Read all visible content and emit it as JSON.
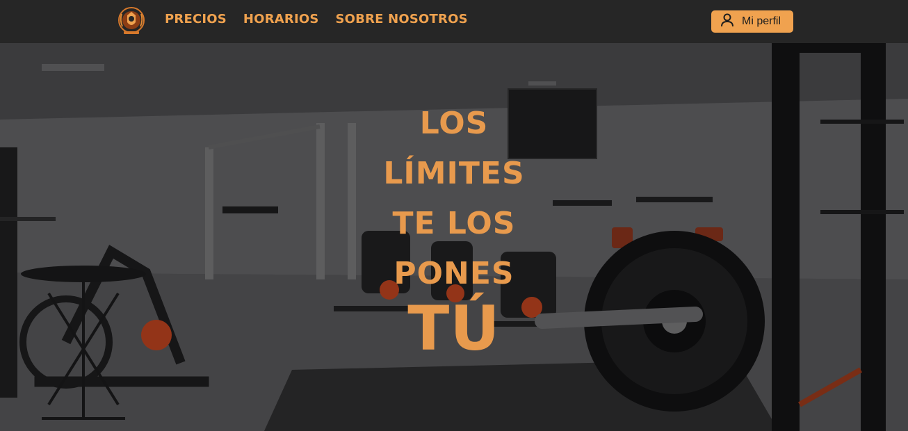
{
  "nav": {
    "logo_icon": "olympus-shield-logo-icon",
    "links": [
      "PRECIOS",
      "HORARIOS",
      "SOBRE NOSOTROS"
    ],
    "profile_label": "Mi perfil",
    "profile_icon": "user-icon"
  },
  "hero": {
    "headline_lines": [
      "LOS",
      "LÍMITES",
      "TE LOS",
      "PONES"
    ],
    "headline_big": "TÚ",
    "background_image": "gym-spin-bikes-photo"
  },
  "colors": {
    "accent": "#f0a24f",
    "navbar": "#262626",
    "hero_text": "#e89a4d"
  }
}
